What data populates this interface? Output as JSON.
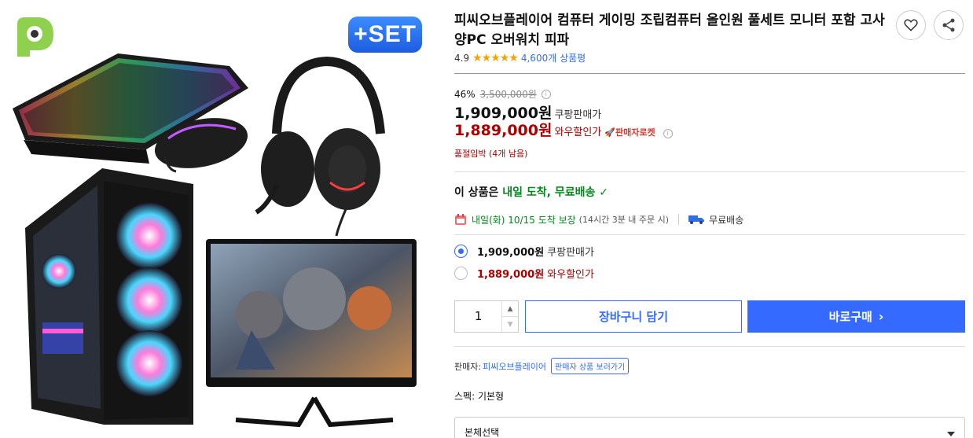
{
  "image": {
    "set_badge": "+SET"
  },
  "product": {
    "title": "피씨오브플레이어 컴퓨터 게이밍 조립컴퓨터 올인원 풀세트 모니터 포함 고사양PC 오버워치 피파",
    "rating": "4.9",
    "stars": "★★★★★",
    "review_count": "4,600개 상품평"
  },
  "pricing": {
    "discount_rate": "46%",
    "original_price": "3,500,000원",
    "coupang_price": "1,909,000원",
    "coupang_price_label": "쿠팡판매가",
    "wow_price": "1,889,000원",
    "wow_price_label": "와우할인가",
    "rocket_seller": "🚀판매자로켓",
    "stock_warning": "품절임박 (4개 남음)"
  },
  "delivery": {
    "headline_prefix": "이 상품은 ",
    "headline_green": "내일 도착, 무료배송",
    "headline_check": "✓",
    "arrival": "내일(화) 10/15 도착 보장",
    "arrival_note": "(14시간 3분 내 주문 시)",
    "free_shipping": "무료배송"
  },
  "options": [
    {
      "price": "1,909,000원",
      "label": "쿠팡판매가",
      "selected": true
    },
    {
      "price": "1,889,000원",
      "label": "와우할인가",
      "selected": false
    }
  ],
  "purchase": {
    "quantity": "1",
    "up": "▲",
    "down": "▼",
    "cart_label": "장바구니 담기",
    "buy_label": "바로구매",
    "buy_chevron": "›"
  },
  "seller": {
    "label": "판매자:",
    "name": "피씨오브플레이어",
    "link_label": "판매자 상품 보러가기"
  },
  "spec": {
    "text": "스펙: 기본형"
  },
  "select": {
    "placeholder": "본체선택"
  },
  "colors": {
    "accent": "#346aff",
    "price_red": "#ae0000",
    "delivery_green": "#00891a",
    "star": "#f5a300"
  }
}
